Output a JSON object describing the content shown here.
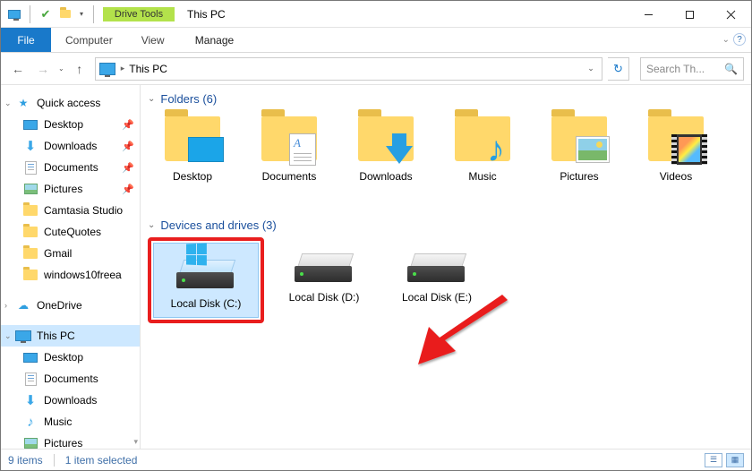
{
  "title": "This PC",
  "drive_tools_label": "Drive Tools",
  "ribbon": {
    "file": "File",
    "tabs": [
      "Computer",
      "View"
    ],
    "manage": "Manage"
  },
  "address": {
    "text": "This PC"
  },
  "search": {
    "placeholder": "Search Th..."
  },
  "sidebar": {
    "quick_access": {
      "label": "Quick access",
      "items": [
        {
          "label": "Desktop",
          "pinned": true,
          "icon": "desktop"
        },
        {
          "label": "Downloads",
          "pinned": true,
          "icon": "downloads"
        },
        {
          "label": "Documents",
          "pinned": true,
          "icon": "docs"
        },
        {
          "label": "Pictures",
          "pinned": true,
          "icon": "pics"
        },
        {
          "label": "Camtasia Studio",
          "pinned": false,
          "icon": "folder"
        },
        {
          "label": "CuteQuotes",
          "pinned": false,
          "icon": "folder"
        },
        {
          "label": "Gmail",
          "pinned": false,
          "icon": "folder"
        },
        {
          "label": "windows10freea",
          "pinned": false,
          "icon": "folder"
        }
      ]
    },
    "onedrive": {
      "label": "OneDrive"
    },
    "this_pc": {
      "label": "This PC",
      "items": [
        {
          "label": "Desktop",
          "icon": "desktop"
        },
        {
          "label": "Documents",
          "icon": "docs"
        },
        {
          "label": "Downloads",
          "icon": "downloads"
        },
        {
          "label": "Music",
          "icon": "music"
        },
        {
          "label": "Pictures",
          "icon": "pics"
        }
      ]
    }
  },
  "groups": {
    "folders": {
      "header": "Folders (6)",
      "items": [
        "Desktop",
        "Documents",
        "Downloads",
        "Music",
        "Pictures",
        "Videos"
      ]
    },
    "drives": {
      "header": "Devices and drives (3)",
      "items": [
        "Local Disk (C:)",
        "Local Disk (D:)",
        "Local Disk (E:)"
      ]
    }
  },
  "status": {
    "count": "9 items",
    "selected": "1 item selected"
  }
}
